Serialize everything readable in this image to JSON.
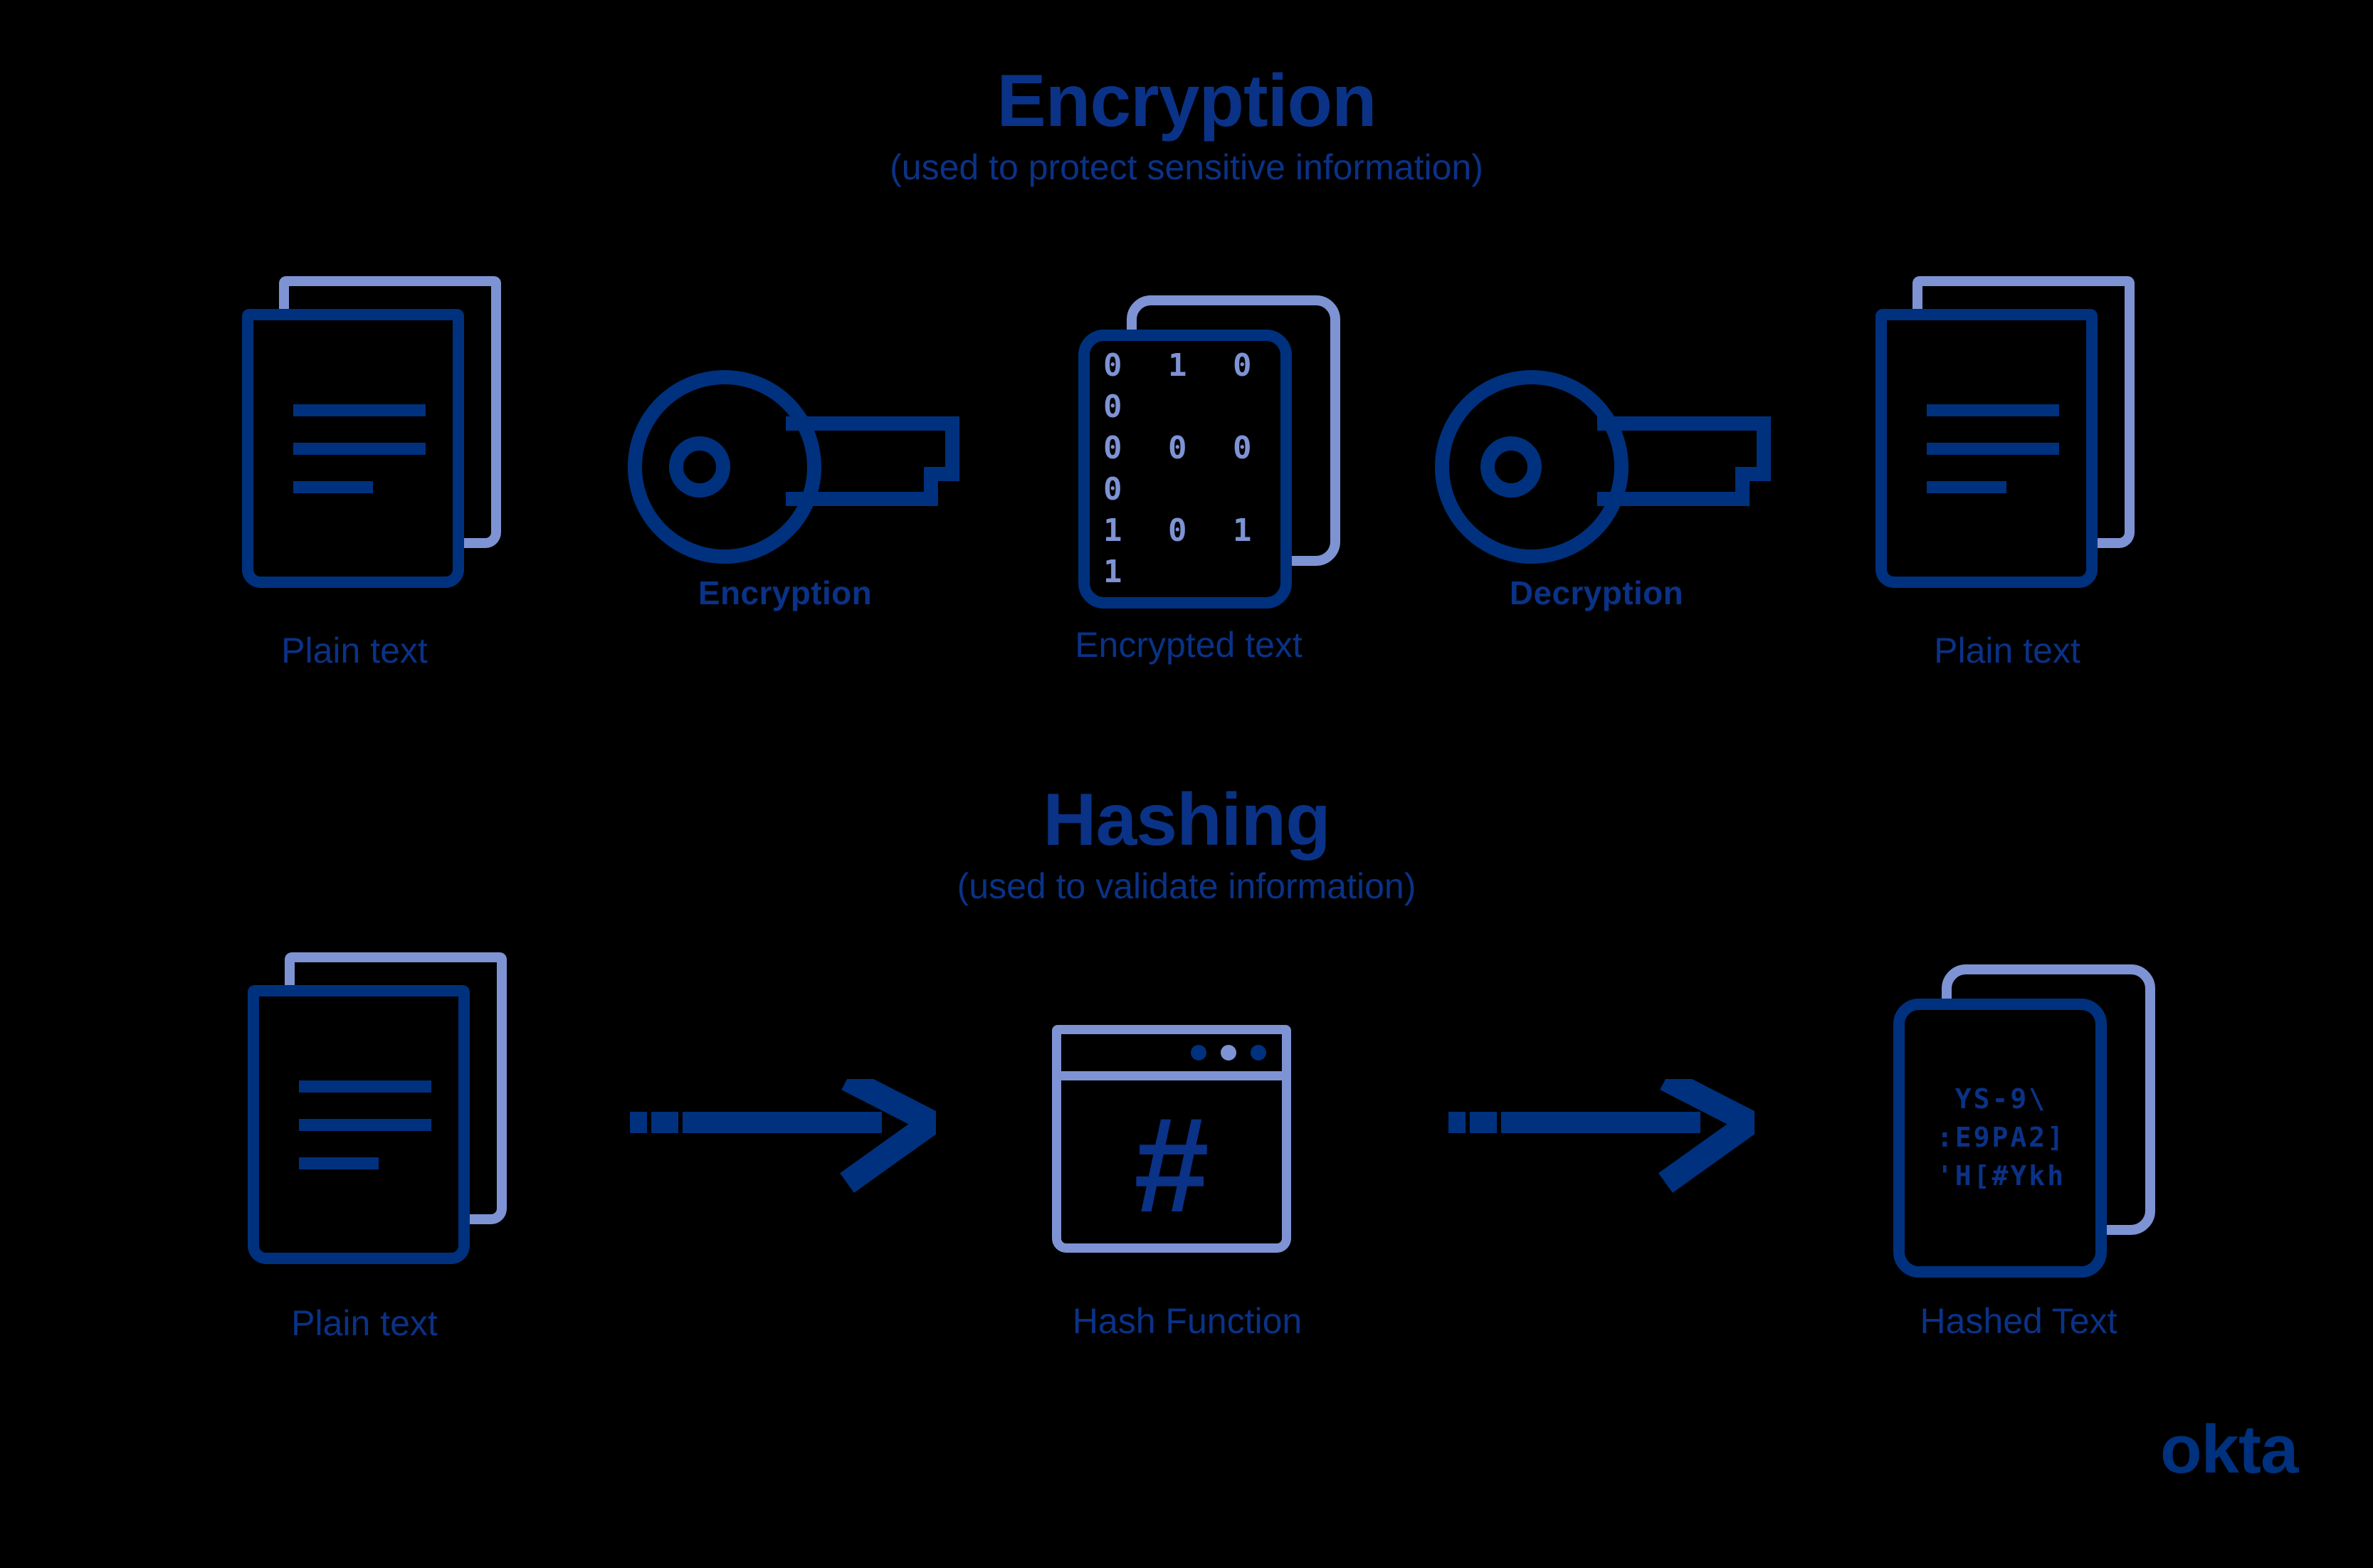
{
  "background_color": "#000000",
  "brand": {
    "logo_text": "okta",
    "color": "#00317e"
  },
  "colors": {
    "dark_blue": "#00317e",
    "title_blue": "#0a3287",
    "periwinkle": "#7e93d4"
  },
  "sections": [
    {
      "id": "encryption",
      "title": "Encryption",
      "subtitle": "(used to protect sensitive information)",
      "steps": [
        {
          "id": "plain-text-in",
          "icon": "document-icon",
          "caption": "Plain text",
          "caption_style": "regular"
        },
        {
          "id": "encryption-key",
          "icon": "key-icon",
          "caption": "Encryption",
          "caption_style": "bold"
        },
        {
          "id": "encrypted-text",
          "icon": "encrypted-card-icon",
          "caption": "Encrypted text",
          "caption_style": "regular",
          "content_rows": [
            "0 1 0 0",
            "0 0 0 0",
            "1 0 1 1"
          ]
        },
        {
          "id": "decryption-key",
          "icon": "key-icon",
          "caption": "Decryption",
          "caption_style": "bold"
        },
        {
          "id": "plain-text-out",
          "icon": "document-icon",
          "caption": "Plain text",
          "caption_style": "regular"
        }
      ]
    },
    {
      "id": "hashing",
      "title": "Hashing",
      "subtitle": "(used to validate information)",
      "steps": [
        {
          "id": "plain-text-hash-in",
          "icon": "document-icon",
          "caption": "Plain text",
          "caption_style": "regular"
        },
        {
          "id": "arrow-1",
          "icon": "dashed-arrow-right-icon",
          "caption": "",
          "caption_style": "regular"
        },
        {
          "id": "hash-function",
          "icon": "hash-window-icon",
          "caption": "Hash Function",
          "caption_style": "regular",
          "glyph": "#"
        },
        {
          "id": "arrow-2",
          "icon": "dashed-arrow-right-icon",
          "caption": "",
          "caption_style": "regular"
        },
        {
          "id": "hashed-text",
          "icon": "hashed-card-icon",
          "caption": "Hashed Text",
          "caption_style": "regular",
          "content_rows": [
            "YS-9\\",
            ":E9PA2]",
            "'H[#Ykh"
          ]
        }
      ]
    }
  ]
}
